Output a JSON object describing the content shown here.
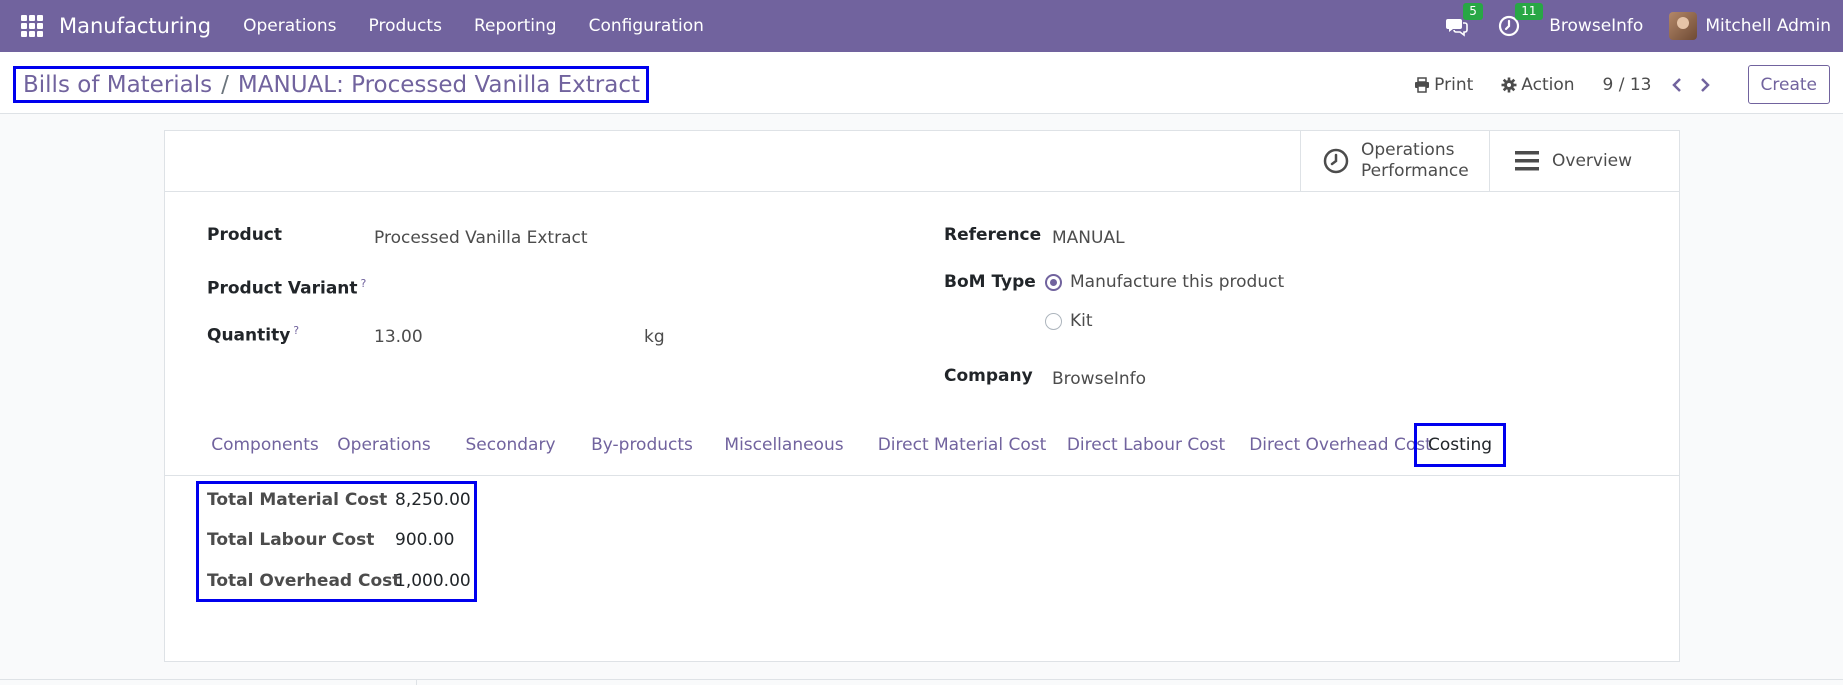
{
  "navbar": {
    "app_name": "Manufacturing",
    "menu": [
      "Operations",
      "Products",
      "Reporting",
      "Configuration"
    ],
    "messages_count": "5",
    "activities_count": "11",
    "company": "BrowseInfo",
    "user": "Mitchell Admin"
  },
  "control_panel": {
    "breadcrumb_parent": "Bills of Materials",
    "breadcrumb_separator": "/",
    "breadcrumb_current": "MANUAL: Processed Vanilla Extract",
    "print_label": "Print",
    "action_label": "Action",
    "pager": "9 / 13",
    "create_label": "Create"
  },
  "smart_buttons": {
    "operations_performance": [
      "Operations",
      "Performance"
    ],
    "overview": "Overview"
  },
  "form": {
    "product_label": "Product",
    "product_value": "Processed Vanilla Extract",
    "variant_label": "Product Variant",
    "variant_help": "?",
    "quantity_label": "Quantity",
    "quantity_help": "?",
    "quantity_value": "13.00",
    "uom_value": "kg",
    "reference_label": "Reference",
    "reference_value": "MANUAL",
    "bom_type_label": "BoM Type",
    "bom_type_options": [
      "Manufacture this product",
      "Kit"
    ],
    "bom_type_selected": "Manufacture this product",
    "company_label": "Company",
    "company_value": "BrowseInfo"
  },
  "tabs": [
    "Components",
    "Operations",
    "Secondary",
    "By-products",
    "Miscellaneous",
    "Direct Material Cost",
    "Direct Labour Cost",
    "Direct Overhead Cost",
    "Costing"
  ],
  "active_tab": "Costing",
  "costing": {
    "material_label": "Total Material Cost",
    "material_value": "8,250.00",
    "labour_label": "Total Labour Cost",
    "labour_value": "900.00",
    "overhead_label": "Total Overhead Cost",
    "overhead_value": "1,000.00"
  },
  "colors": {
    "brand": "#71639e",
    "highlight": "#0000ee",
    "badge": "#28a745"
  }
}
